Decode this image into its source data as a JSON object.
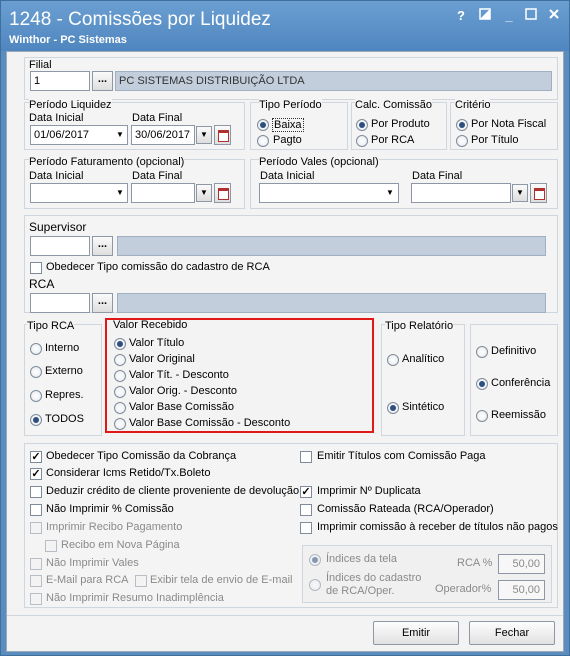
{
  "window": {
    "title": "1248 - Comissões por Liquidez",
    "subtitle": "Winthor - PC Sistemas",
    "help": "?",
    "minimize": "_"
  },
  "filial": {
    "label": "Filial",
    "code": "1",
    "name": "PC SISTEMAS DISTRIBUIÇÃO LTDA",
    "btn": "..."
  },
  "periodo_liquidez": {
    "title": "Período Liquidez",
    "inicial_label": "Data Inicial",
    "final_label": "Data Final",
    "inicial": "01/06/2017",
    "final": "30/06/2017"
  },
  "tipo_periodo": {
    "title": "Tipo Período",
    "opt1": "Baixa",
    "opt2": "Pagto"
  },
  "calc_comissao": {
    "title": "Calc. Comissão",
    "opt1": "Por Produto",
    "opt2": "Por RCA"
  },
  "criterio": {
    "title": "Critério",
    "opt1": "Por Nota Fiscal",
    "opt2": "Por Título"
  },
  "periodo_faturamento": {
    "title": "Período Faturamento  (opcional)",
    "inicial_label": "Data Inicial",
    "final_label": "Data Final"
  },
  "periodo_vales": {
    "title": "Período Vales  (opcional)",
    "inicial_label": "Data Inicial",
    "final_label": "Data Final"
  },
  "supervisor": {
    "label": "Supervisor",
    "btn": "...",
    "check": "Obedecer Tipo comissão do cadastro de RCA"
  },
  "rca": {
    "label": "RCA",
    "btn": "..."
  },
  "tipo_rca": {
    "title": "Tipo RCA",
    "opts": [
      "Interno",
      "Externo",
      "Repres.",
      "TODOS"
    ]
  },
  "valor_recebido": {
    "title": "Valor Recebido",
    "opts": [
      "Valor Título",
      "Valor Original",
      "Valor Tít. - Desconto",
      "Valor Orig. - Desconto",
      "Valor Base Comissão",
      "Valor Base Comissão - Desconto"
    ]
  },
  "tipo_relatorio": {
    "title": "Tipo Relatório",
    "opt1": "Analítico",
    "opt2": "Sintético"
  },
  "modo": {
    "opts": [
      "Definitivo",
      "Conferência",
      "Reemissão"
    ]
  },
  "options_left": [
    "Obedecer Tipo Comissão da Cobrança",
    "Considerar Icms Retido/Tx.Boleto",
    "Deduzir crédito de cliente proveniente de devolução",
    "Não Imprimir % Comissão",
    "Imprimir Recibo Pagamento",
    "Recibo em Nova Página",
    "Não Imprimir Vales",
    "E-Mail para RCA",
    "Exibir tela de envio de E-mail",
    "Não Imprimir Resumo Inadimplência"
  ],
  "options_right": [
    "Emitir Títulos com Comissão Paga",
    "Imprimir Nº Duplicata",
    "Comissão Rateada (RCA/Operador)",
    "Imprimir comissão à receber de títulos não pagos"
  ],
  "indices": {
    "opt1": "Índices da tela",
    "opt2": "Índices do cadastro de RCA/Oper.",
    "rca_label": "RCA %",
    "rca_value": "50,00",
    "op_label": "Operador%",
    "op_value": "50,00"
  },
  "buttons": {
    "emitir": "Emitir",
    "fechar": "Fechar"
  }
}
